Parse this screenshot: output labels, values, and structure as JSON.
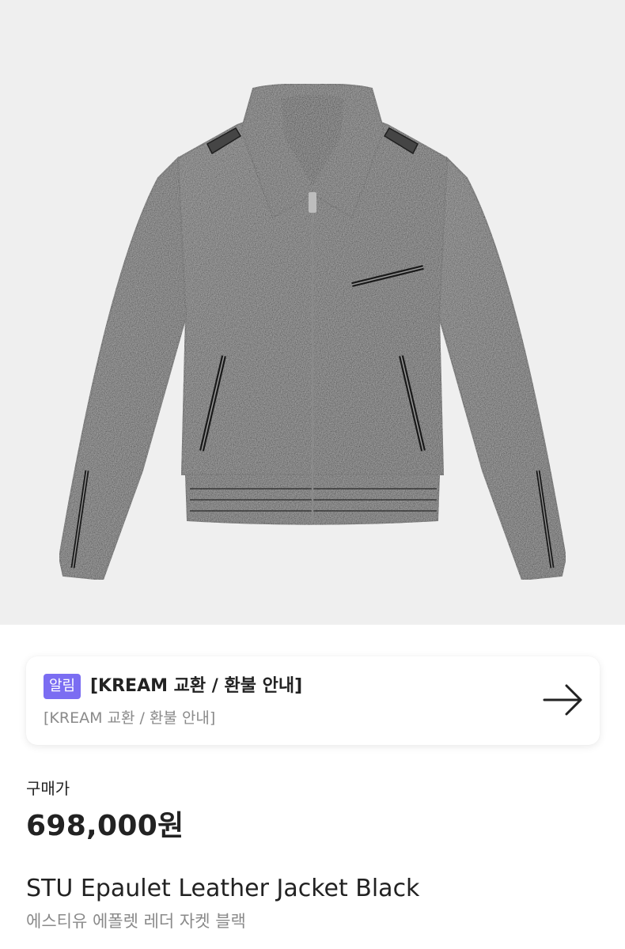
{
  "product_image": {
    "alt_icon": "leather-jacket-photo",
    "background": "#efefef"
  },
  "notice": {
    "badge": "알림",
    "title": "[KREAM 교환 / 환불 안내]",
    "subtitle": "[KREAM 교환 / 환불 안내]",
    "arrow_icon": "arrow-right-icon",
    "badge_color": "#7b6df2"
  },
  "price": {
    "label": "구매가",
    "value": "698,000원"
  },
  "product": {
    "name": "STU Epaulet Leather Jacket Black",
    "name_ko": "에스티유 에폴렛 레더 자켓 블랙"
  }
}
